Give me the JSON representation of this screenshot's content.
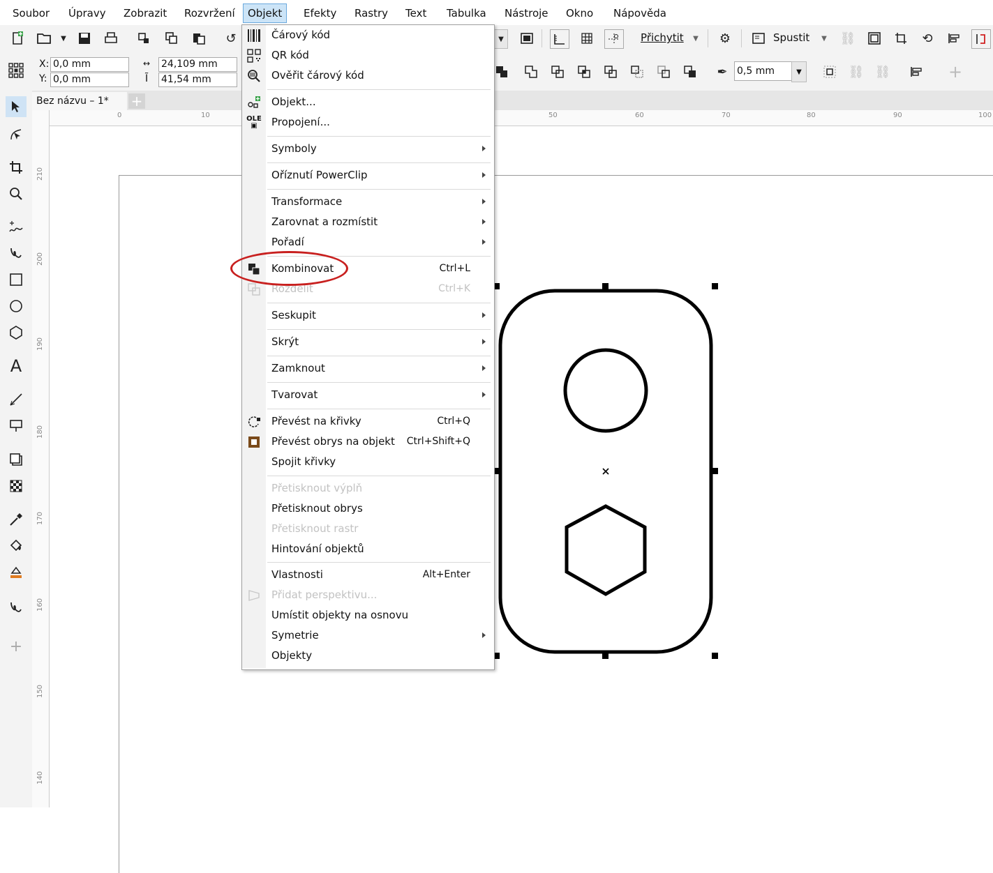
{
  "menubar": {
    "items": [
      "Soubor",
      "Úpravy",
      "Zobrazit",
      "Rozvržení",
      "Objekt",
      "Efekty",
      "Rastry",
      "Text",
      "Tabulka",
      "Nástroje",
      "Okno",
      "Nápověda"
    ],
    "active": "Objekt"
  },
  "toolbar": {
    "snap_label": "Přichytit",
    "launch_label": "Spustit",
    "x_label": "X:",
    "y_label": "Y:",
    "x_value": "0,0 mm",
    "y_value": "0,0 mm",
    "width_value": "24,109 mm",
    "height_value": "41,54 mm",
    "outline_width": "0,5 mm"
  },
  "document": {
    "tab_title": "Bez názvu – 1*"
  },
  "ruler": {
    "h_numbers": [
      "0",
      "10",
      "50",
      "60",
      "70",
      "80",
      "90",
      "100"
    ],
    "v_numbers": [
      "210",
      "200",
      "190",
      "180",
      "170",
      "160",
      "150",
      "140"
    ]
  },
  "menu": {
    "items": [
      {
        "label": "Čárový kód",
        "icon": "barcode-icon"
      },
      {
        "label": "QR kód",
        "icon": "qr-code-icon"
      },
      {
        "label": "Ověřit čárový kód",
        "icon": "verify-barcode-icon"
      },
      {
        "label": "Objekt...",
        "icon": "insert-object-icon"
      },
      {
        "label": "Propojení...",
        "icon": "ole-link-icon"
      },
      {
        "label": "Symboly",
        "submenu": true
      },
      {
        "label": "Oříznutí PowerClip",
        "submenu": true
      },
      {
        "label": "Transformace",
        "submenu": true
      },
      {
        "label": "Zarovnat a rozmístit",
        "submenu": true
      },
      {
        "label": "Pořadí",
        "submenu": true
      },
      {
        "label": "Kombinovat",
        "shortcut": "Ctrl+L",
        "icon": "combine-icon"
      },
      {
        "label": "Rozdělit",
        "shortcut": "Ctrl+K",
        "icon": "break-apart-icon",
        "disabled": true
      },
      {
        "label": "Seskupit",
        "submenu": true
      },
      {
        "label": "Skrýt",
        "submenu": true
      },
      {
        "label": "Zamknout",
        "submenu": true
      },
      {
        "label": "Tvarovat",
        "submenu": true
      },
      {
        "label": "Převést na křivky",
        "shortcut": "Ctrl+Q",
        "icon": "convert-to-curves-icon"
      },
      {
        "label": "Převést obrys na objekt",
        "shortcut": "Ctrl+Shift+Q",
        "icon": "outline-to-object-icon"
      },
      {
        "label": "Spojit křivky"
      },
      {
        "label": "Přetisknout výplň",
        "disabled": true
      },
      {
        "label": "Přetisknout obrys"
      },
      {
        "label": "Přetisknout rastr",
        "disabled": true
      },
      {
        "label": "Hintování objektů"
      },
      {
        "label": "Vlastnosti",
        "shortcut": "Alt+Enter"
      },
      {
        "label": "Přidat perspektivu...",
        "icon": "perspective-icon",
        "disabled": true
      },
      {
        "label": "Umístit objekty na osnovu"
      },
      {
        "label": "Symetrie",
        "submenu": true
      },
      {
        "label": "Objekty"
      }
    ]
  },
  "colors": {
    "highlight_ellipse": "#c8201f",
    "menu_active_bg": "#cce4f7",
    "menu_active_border": "#6aa9dd"
  }
}
